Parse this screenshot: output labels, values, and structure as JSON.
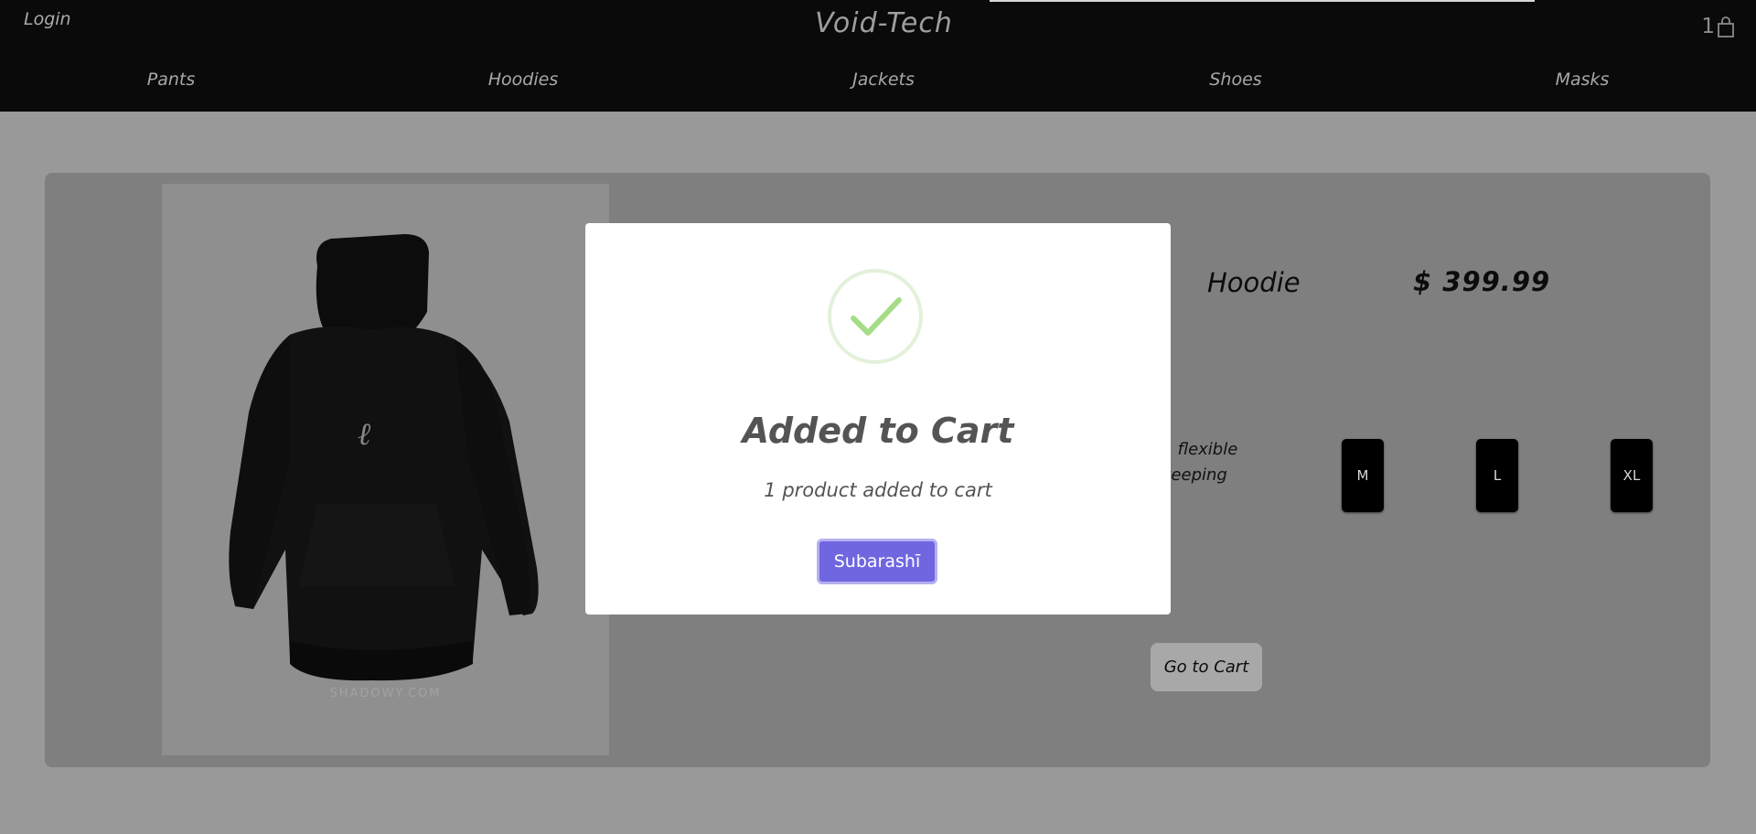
{
  "header": {
    "login_label": "Login",
    "brand": "Void-Tech",
    "cart_count": "1"
  },
  "nav": {
    "items": [
      {
        "label": "Pants"
      },
      {
        "label": "Hoodies"
      },
      {
        "label": "Jackets"
      },
      {
        "label": "Shoes"
      },
      {
        "label": "Masks"
      }
    ]
  },
  "product": {
    "name": "Hoodie",
    "price": "$ 399.99",
    "description_line1": ", flexible",
    "description_line2": "keeping",
    "image_watermark": "SHADOWY.COM",
    "sizes": [
      "M",
      "L",
      "XL"
    ],
    "go_to_cart_label": "Go to Cart"
  },
  "modal": {
    "title": "Added to Cart",
    "text": "1 product added to cart",
    "confirm_label": "Subarashī"
  },
  "colors": {
    "header_bg": "#0a0a0a",
    "overlay_bg": "#999999",
    "card_bg": "#7f7f7f",
    "modal_button": "#7066e0",
    "success_check": "#a5dc86"
  }
}
